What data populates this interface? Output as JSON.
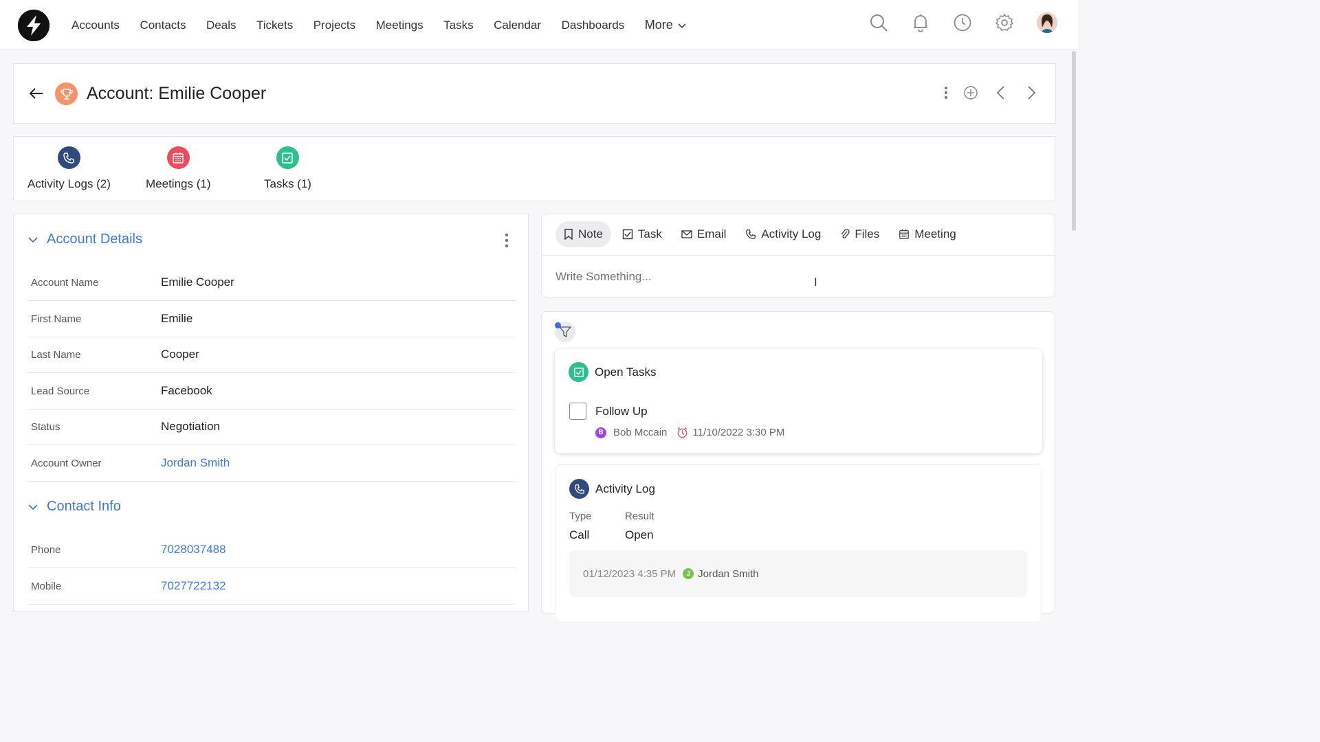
{
  "nav": {
    "items": [
      "Accounts",
      "Contacts",
      "Deals",
      "Tickets",
      "Projects",
      "Meetings",
      "Tasks",
      "Calendar",
      "Dashboards"
    ],
    "more_label": "More",
    "icons": [
      "search-icon",
      "bell-icon",
      "clock-icon",
      "gear-icon",
      "avatar"
    ]
  },
  "header": {
    "title": "Account: Emilie Cooper"
  },
  "related": [
    {
      "label": "Activity Logs (2)",
      "icon": "phone-icon",
      "color": "#2f4a7c"
    },
    {
      "label": "Meetings (1)",
      "icon": "calendar-icon",
      "color": "#ec4b5e"
    },
    {
      "label": "Tasks (1)",
      "icon": "check-square-icon",
      "color": "#2fbf8f"
    }
  ],
  "account_details": {
    "title": "Account Details",
    "fields": [
      {
        "label": "Account Name",
        "value": "Emilie Cooper"
      },
      {
        "label": "First Name",
        "value": "Emilie"
      },
      {
        "label": "Last Name",
        "value": "Cooper"
      },
      {
        "label": "Lead Source",
        "value": "Facebook"
      },
      {
        "label": "Status",
        "value": "Negotiation"
      },
      {
        "label": "Account Owner",
        "value": "Jordan Smith"
      }
    ]
  },
  "contact_info": {
    "title": "Contact Info",
    "fields": [
      {
        "label": "Phone",
        "value": "7028037488"
      },
      {
        "label": "Mobile",
        "value": "7027722132"
      }
    ]
  },
  "composer": {
    "tabs": [
      "Note",
      "Task",
      "Email",
      "Activity Log",
      "Files",
      "Meeting"
    ],
    "active_tab": "Note",
    "placeholder": "Write Something..."
  },
  "open_tasks": {
    "title": "Open Tasks",
    "task_title": "Follow Up",
    "assignee": "Bob Mccain",
    "assignee_initial": "B",
    "due": "11/10/2022 3:30 PM"
  },
  "activity_log": {
    "title": "Activity Log",
    "type_label": "Type",
    "type_value": "Call",
    "result_label": "Result",
    "result_value": "Open",
    "timestamp": "01/12/2023 4:35 PM",
    "owner": "Jordan Smith",
    "owner_initial": "J"
  },
  "colors": {
    "accent": "#3d7bd6",
    "trophy": "#f6936b",
    "tasks_green": "#2fbf8f",
    "meetings_red": "#ec4b5e",
    "activity_navy": "#2f4a7c",
    "bob_purple": "#a648e0",
    "jordan_green": "#7fbf4d",
    "due_red": "#e05252"
  }
}
